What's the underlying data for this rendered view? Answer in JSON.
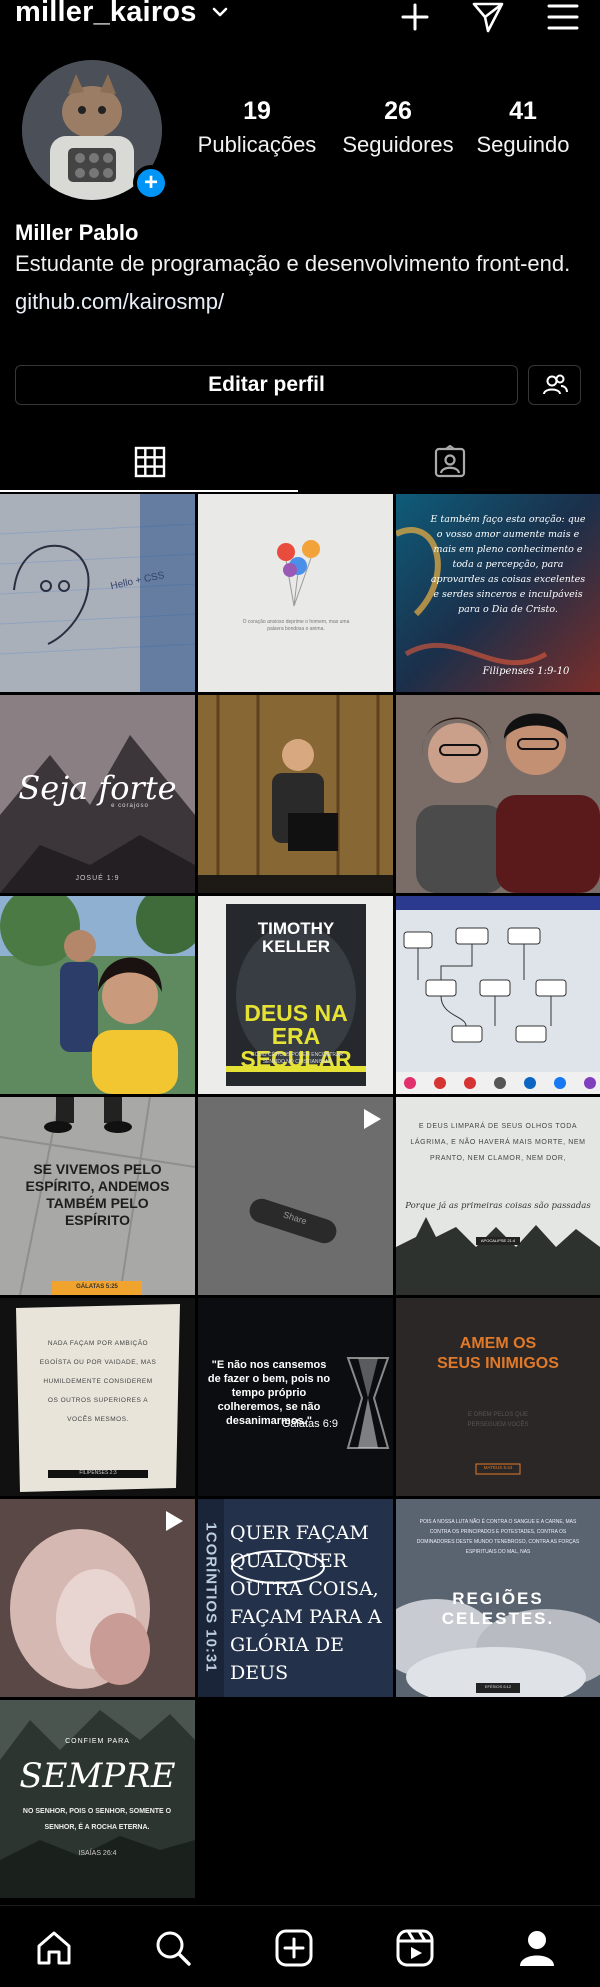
{
  "header": {
    "username": "miller_kairos",
    "icons": [
      "chevron-down-icon",
      "plus-icon",
      "send-icon",
      "menu-icon"
    ]
  },
  "profile": {
    "posts": {
      "count": "19",
      "label": "Publicações"
    },
    "followers": {
      "count": "26",
      "label": "Seguidores"
    },
    "following": {
      "count": "41",
      "label": "Seguindo"
    },
    "name": "Miller Pablo",
    "bio": "Estudante de programação e desenvolvimento front-end.",
    "link": "github.com/kairosmp/"
  },
  "actions": {
    "edit_profile": "Editar perfil",
    "suggest_icon": "add-people-icon"
  },
  "tabs": [
    {
      "icon": "grid-icon",
      "active": true
    },
    {
      "icon": "tagged-icon",
      "active": false
    }
  ],
  "posts": [
    {
      "bg": "#4a5870",
      "texts": [
        "Hello + CSS"
      ]
    },
    {
      "bg": "#e8e8e6",
      "texts": [
        "O coração ansioso deprime o homem, mas uma palavra bondosa o anima."
      ]
    },
    {
      "bg": "#16344a",
      "texts": [
        "E também faço esta oração: que o vosso amor aumente mais e mais em pleno conhecimento e toda a percepção, para aprovardes as coisas excelentes e serdes sinceros e inculpáveis para o Dia de Cristo.",
        "Filipenses 1:9-10"
      ]
    },
    {
      "bg": "#6a5e5e",
      "texts": [
        "Seja forte",
        "e corajoso",
        "JOSUÉ 1:9"
      ]
    },
    {
      "bg": "#6b5030",
      "texts": []
    },
    {
      "bg": "#7a6a66",
      "texts": []
    },
    {
      "bg": "#4f6e50",
      "texts": []
    },
    {
      "bg": "#2a2e33",
      "texts": [
        "TIMOTHY KELLER",
        "DEUS NA ERA SECULAR",
        "COMO CÉTICOS PODEM ENCONTRAR SENTIDO NO CRISTIANISMO"
      ]
    },
    {
      "bg": "#dfe4ea",
      "texts": []
    },
    {
      "bg": "#a7a7a5",
      "texts": [
        "SE VIVEMOS PELO ESPÍRITO, ANDEMOS TAMBÉM PELO ESPÍRITO",
        "GÁLATAS 5:25"
      ]
    },
    {
      "bg": "#7c7c7c",
      "texts": [
        "Share"
      ]
    },
    {
      "bg": "#e4e6e4",
      "texts": [
        "E DEUS LIMPARÁ DE SEUS OLHOS TODA LÁGRIMA, E NÃO HAVERÁ MAIS MORTE, NEM PRANTO, NEM CLAMOR, NEM DOR,",
        "Porque já as primeiras coisas são passadas",
        "APOCALIPSE 21:4"
      ]
    },
    {
      "bg": "#e8e4da",
      "texts": [
        "NADA FAÇAM POR AMBIÇÃO EGOÍSTA OU POR VAIDADE, MAS HUMILDEMENTE CONSIDEREM OS OUTROS SUPERIORES A VOCÊS MESMOS.",
        "FILIPENSES 2:3"
      ]
    },
    {
      "bg": "#0b0d10",
      "texts": [
        "\"E não nos cansemos de fazer o bem, pois no tempo próprio colheremos, se não desanimarmos.\"",
        "Gálatas 6:9"
      ]
    },
    {
      "bg": "#3a3532",
      "texts": [
        "AMEM OS SEUS INIMIGOS",
        "E OREM PELOS QUE PERSEGUEM VOCÊS",
        "MATEUS 5:44"
      ]
    },
    {
      "bg": "#b69a94",
      "texts": []
    },
    {
      "bg": "#23314a",
      "texts": [
        "1CORÍNTIOS 10:31",
        "QUER FAÇAM QUALQUER OUTRA COISA, FAÇAM PARA A GLÓRIA DE DEUS"
      ]
    },
    {
      "bg": "#5a6470",
      "texts": [
        "POIS A NOSSA LUTA NÃO É CONTRA O SANGUE E A CARNE, MAS CONTRA OS PRINCIPADOS E POTESTADES, CONTRA OS DOMINADORES DESTE MUNDO TENEBROSO, CONTRA AS FORÇAS ESPIRITUAIS DO MAL, NAS",
        "REGIÕES CELESTES.",
        "EFÉSIOS 6:12"
      ]
    },
    {
      "bg": "#2d3530",
      "texts": [
        "CONFIEM PARA",
        "SEMPRE",
        "NO SENHOR, POIS O SENHOR, SOMENTE O SENHOR, É A ROCHA ETERNA.",
        "ISAÍAS 26:4"
      ]
    }
  ],
  "bottom_nav": [
    {
      "icon": "home-icon"
    },
    {
      "icon": "search-icon"
    },
    {
      "icon": "add-post-icon"
    },
    {
      "icon": "reels-icon"
    },
    {
      "icon": "profile-icon",
      "active": true
    }
  ]
}
